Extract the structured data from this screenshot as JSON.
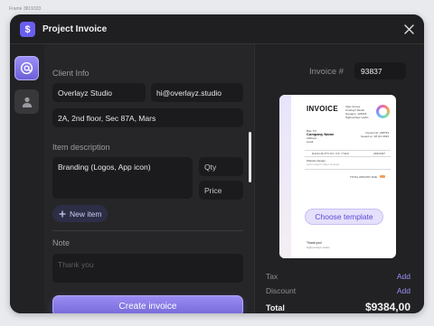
{
  "frame_label": "Frame 3819333",
  "window": {
    "title": "Project Invoice",
    "app_icon_glyph": "$",
    "close_icon": "close-icon"
  },
  "sidebar": {
    "items": [
      {
        "icon": "at-icon",
        "active": true
      },
      {
        "icon": "user-icon",
        "active": false
      }
    ]
  },
  "client": {
    "section_label": "Client Info",
    "name": "Overlayz Studio",
    "email": "hi@overlayz.studio",
    "address": "2A, 2nd floor, Sec 87A, Mars"
  },
  "item": {
    "section_label": "Item description",
    "description": "Branding (Logos, App icon)",
    "qty_placeholder": "Qty",
    "price_placeholder": "Price",
    "new_item_label": "New item"
  },
  "note": {
    "section_label": "Note",
    "placeholder": "Thank you"
  },
  "create_button": "Create invoice",
  "invoice": {
    "number_label": "Invoice #",
    "number": "93837"
  },
  "preview": {
    "title": "INVOICE",
    "from_lines": [
      "Vijay Verma",
      "Overlayz Studio",
      "Gurgaon, 122018",
      "hi@overlayz.studio"
    ],
    "bill_to_label": "BILL TO",
    "bill_to_name": "Company Name",
    "bill_to_address": "Address",
    "bill_to_email": "email",
    "invoice_no_label": "Invoice No: 238763",
    "issued_label": "Issued on: 28 Oct 2023",
    "desc_header": "DESCRIPTION OF ITEM",
    "amount_header": "AMOUNT",
    "row_title": "Website Design",
    "row_detail": "Lorem ipsum dolor sit amet",
    "total_label": "TOTAL AMOUNT DUE",
    "thanks": "Thank you!",
    "footer": "hi@overlayz.studio",
    "choose_template": "Choose template"
  },
  "summary": {
    "tax_label": "Tax",
    "tax_action": "Add",
    "discount_label": "Discount",
    "discount_action": "Add",
    "total_label": "Total",
    "total_value": "$9384,00"
  },
  "colors": {
    "accent": "#6a5ef0",
    "window_bg": "#262628",
    "field_bg": "#1b1b1d",
    "page_bg": "#e9eaee"
  }
}
